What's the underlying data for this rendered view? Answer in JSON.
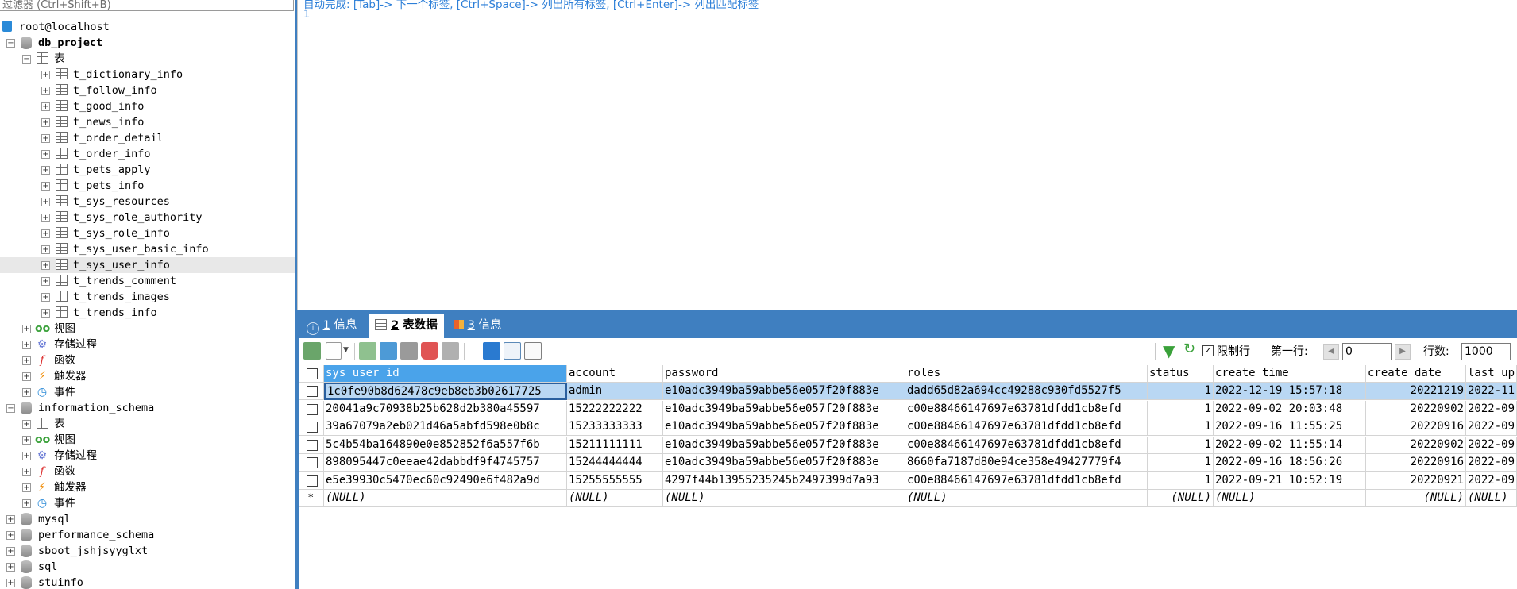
{
  "filter": {
    "placeholder": "过滤器 (Ctrl+Shift+B)"
  },
  "tree": {
    "connection": "root@localhost",
    "db_project": {
      "name": "db_project",
      "tables_folder": "表",
      "tables": [
        "t_dictionary_info",
        "t_follow_info",
        "t_good_info",
        "t_news_info",
        "t_order_detail",
        "t_order_info",
        "t_pets_apply",
        "t_pets_info",
        "t_sys_resources",
        "t_sys_role_authority",
        "t_sys_role_info",
        "t_sys_user_basic_info",
        "t_sys_user_info",
        "t_trends_comment",
        "t_trends_images",
        "t_trends_info"
      ],
      "selected_table": "t_sys_user_info",
      "views": "视图",
      "procedures": "存储过程",
      "functions": "函数",
      "triggers": "触发器",
      "events": "事件"
    },
    "information_schema": {
      "name": "information_schema",
      "tables_folder": "表",
      "views": "视图",
      "procedures": "存储过程",
      "functions": "函数",
      "triggers": "触发器",
      "events": "事件"
    },
    "other_dbs": [
      "mysql",
      "performance_schema",
      "sboot_jshjsyyglxt",
      "sql",
      "stuinfo"
    ]
  },
  "editor": {
    "hint": "自动完成: [Tab]-> 下一个标签, [Ctrl+Space]-> 列出所有标签, [Ctrl+Enter]-> 列出匹配标签",
    "line_number": "1"
  },
  "tabs": [
    {
      "num": "1",
      "label": "信息",
      "icon": "info-icon"
    },
    {
      "num": "2",
      "label": "表数据",
      "icon": "table-icon",
      "active": true
    },
    {
      "num": "3",
      "label": "信息",
      "icon": "chart-icon"
    }
  ],
  "toolbar": {
    "limit_label": "限制行",
    "limit_checked": true,
    "first_row_label": "第一行:",
    "first_row_value": "0",
    "rows_label": "行数:",
    "rows_value": "1000"
  },
  "grid": {
    "columns": [
      "sys_user_id",
      "account",
      "password",
      "roles",
      "status",
      "create_time",
      "create_date",
      "last_up"
    ],
    "rows": [
      [
        "1c0fe90b8d62478c9eb8eb3b02617725",
        "admin",
        "e10adc3949ba59abbe56e057f20f883e",
        "dadd65d82a694cc49288c930fd5527f5",
        "1",
        "2022-12-19 15:57:18",
        "20221219",
        "2022-11"
      ],
      [
        "20041a9c70938b25b628d2b380a45597",
        "15222222222",
        "e10adc3949ba59abbe56e057f20f883e",
        "c00e88466147697e63781dfdd1cb8efd",
        "1",
        "2022-09-02 20:03:48",
        "20220902",
        "2022-09"
      ],
      [
        "39a67079a2eb021d46a5abfd598e0b8c",
        "15233333333",
        "e10adc3949ba59abbe56e057f20f883e",
        "c00e88466147697e63781dfdd1cb8efd",
        "1",
        "2022-09-16 11:55:25",
        "20220916",
        "2022-09"
      ],
      [
        "5c4b54ba164890e0e852852f6a557f6b",
        "15211111111",
        "e10adc3949ba59abbe56e057f20f883e",
        "c00e88466147697e63781dfdd1cb8efd",
        "1",
        "2022-09-02 11:55:14",
        "20220902",
        "2022-09"
      ],
      [
        "898095447c0eeae42dabbdf9f4745757",
        "15244444444",
        "e10adc3949ba59abbe56e057f20f883e",
        "8660fa7187d80e94ce358e49427779f4",
        "1",
        "2022-09-16 18:56:26",
        "20220916",
        "2022-09"
      ],
      [
        "e5e39930c5470ec60c92490e6f482a9d",
        "15255555555",
        "4297f44b13955235245b2497399d7a93",
        "c00e88466147697e63781dfdd1cb8efd",
        "1",
        "2022-09-21 10:52:19",
        "20220921",
        "2022-09"
      ]
    ],
    "null_row": [
      "(NULL)",
      "(NULL)",
      "(NULL)",
      "(NULL)",
      "(NULL)",
      "(NULL)",
      "(NULL)",
      "(NULL)"
    ],
    "new_row_marker": "*"
  },
  "colors": {
    "accent": "#3f7fc0",
    "header_highlight": "#4aa3ea",
    "selected_row": "#b9d7f3",
    "hint": "#2d7fd8"
  }
}
